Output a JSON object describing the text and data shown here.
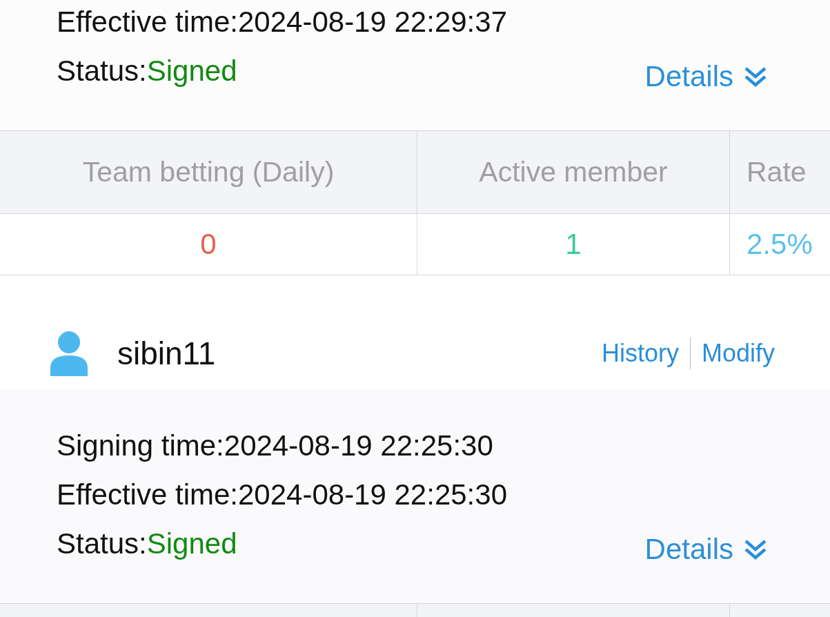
{
  "top_card": {
    "lines": [
      {
        "label": "Effective time:",
        "value": "2024-08-19 22:29:37"
      }
    ],
    "status_label": "Status:",
    "status": "Signed",
    "details": "Details"
  },
  "table": {
    "columns": [
      "Team betting (Daily)",
      "Active member",
      "Rate"
    ],
    "row": [
      {
        "value": "0",
        "color": "#e5604a"
      },
      {
        "value": "1",
        "color": "#3cc9a0"
      },
      {
        "value": "2.5%",
        "color": "#5bc0eb"
      }
    ]
  },
  "member": {
    "name": "sibin11",
    "actions": [
      "History",
      "Modify"
    ],
    "lines": [
      {
        "label": "Signing time:",
        "value": "2024-08-19 22:25:30"
      },
      {
        "label": "Effective time:",
        "value": "2024-08-19 22:25:30"
      }
    ],
    "status_label": "Status:",
    "status": "Signed",
    "details": "Details"
  }
}
